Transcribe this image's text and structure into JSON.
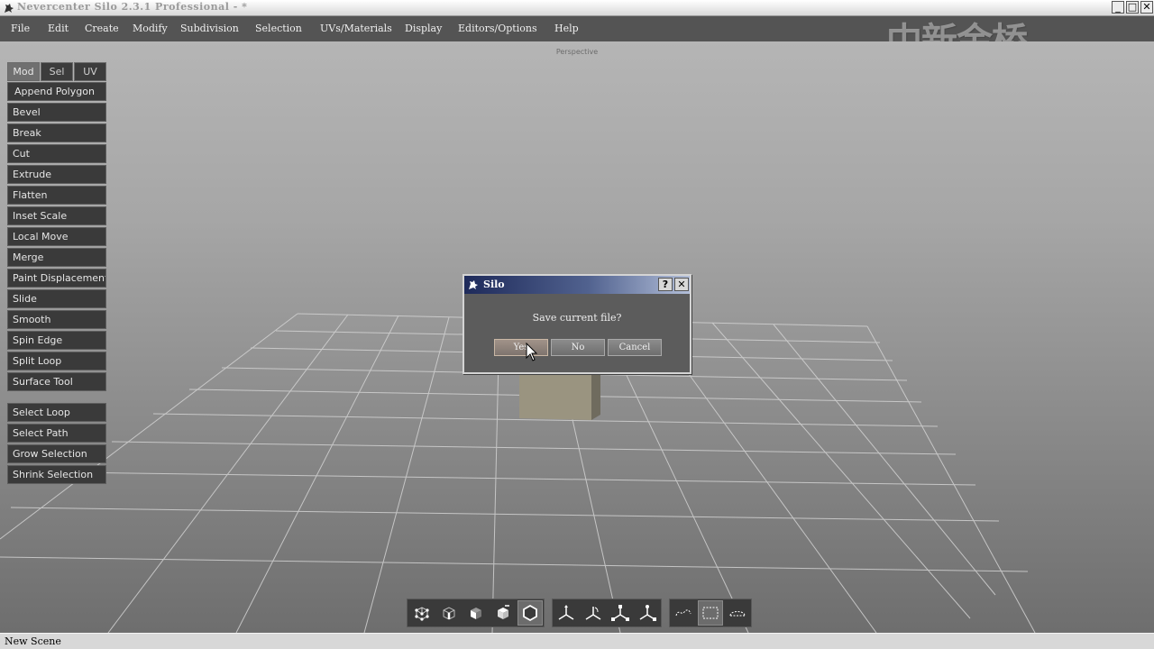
{
  "window": {
    "title": "Nevercenter Silo 2.3.1 Professional - *",
    "minimize": "_",
    "maximize": "□",
    "close": "✕"
  },
  "menu": [
    "File",
    "Edit",
    "Create",
    "Modify",
    "Subdivision",
    "Selection",
    "UVs/Materials",
    "Display",
    "Editors/Options",
    "Help"
  ],
  "watermark": "中新金桥",
  "viewport": {
    "label": "Perspective"
  },
  "panel": {
    "tabs": [
      "Mod",
      "Sel",
      "UV"
    ],
    "active_tab": "Mod",
    "tools": [
      "Append Polygon",
      "Bevel",
      "Break",
      "Cut",
      "Extrude",
      "Flatten",
      "Inset Scale",
      "Local Move",
      "Merge",
      "Paint Displacement",
      "Slide",
      "Smooth",
      "Spin Edge",
      "Split Loop",
      "Surface Tool"
    ],
    "selection_tools": [
      "Select Loop",
      "Select Path",
      "Grow Selection",
      "Shrink Selection"
    ]
  },
  "bottom_toolbar": {
    "selection_modes": [
      "vertex-mode-icon",
      "edge-mode-icon",
      "face-mode-icon",
      "object-mode-icon",
      "geometry-mode-icon"
    ],
    "manipulators": [
      "move-manipulator-icon",
      "rotate-manipulator-icon",
      "scale-manipulator-icon",
      "universal-manipulator-icon"
    ],
    "select_styles": [
      "lasso-select-icon",
      "box-select-icon",
      "paint-select-icon"
    ]
  },
  "dialog": {
    "title": "Silo",
    "help": "?",
    "close": "✕",
    "message": "Save current file?",
    "buttons": [
      "Yes",
      "No",
      "Cancel"
    ]
  },
  "status": {
    "text": "New Scene"
  },
  "colors": {
    "viewport_top": "#b5b5b5",
    "panel_button": "#3a3a3a",
    "dialog_title_start": "#1e2a5a",
    "menu_bar": "#545454"
  }
}
